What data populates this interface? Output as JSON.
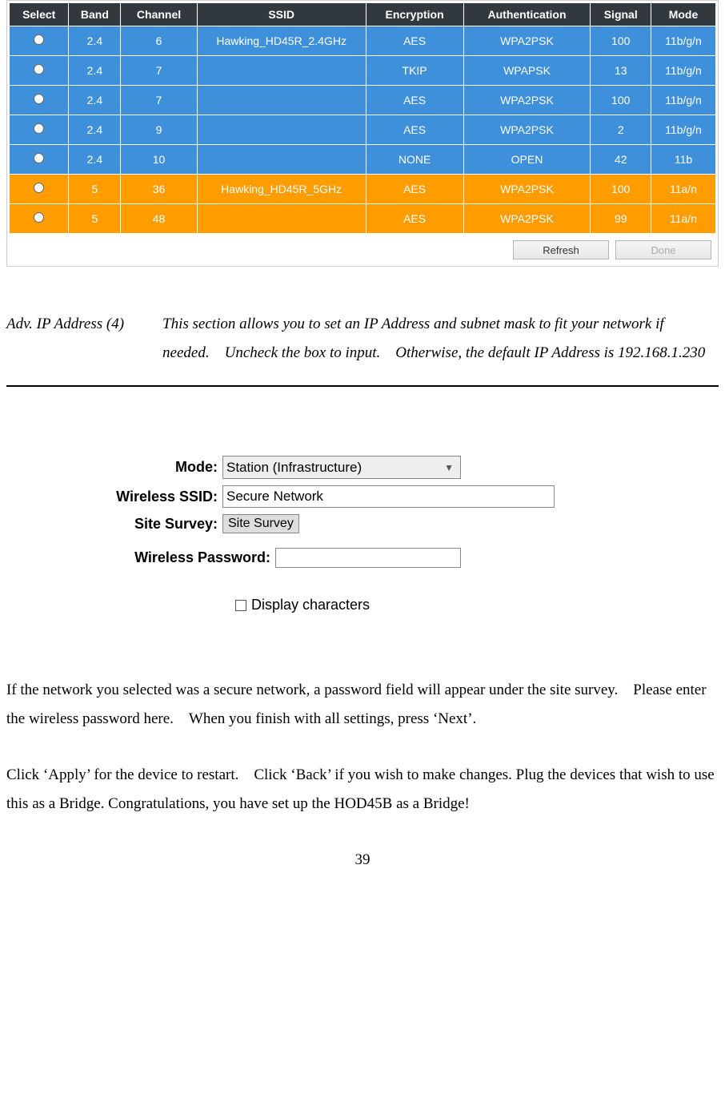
{
  "table": {
    "headers": [
      "Select",
      "Band",
      "Channel",
      "SSID",
      "Encryption",
      "Authentication",
      "Signal",
      "Mode"
    ],
    "rows": [
      {
        "cls": "blue",
        "band": "2.4",
        "channel": "6",
        "ssid": "Hawking_HD45R_2.4GHz",
        "enc": "AES",
        "auth": "WPA2PSK",
        "signal": "100",
        "mode": "11b/g/n"
      },
      {
        "cls": "blue",
        "band": "2.4",
        "channel": "7",
        "ssid": "",
        "enc": "TKIP",
        "auth": "WPAPSK",
        "signal": "13",
        "mode": "11b/g/n"
      },
      {
        "cls": "blue",
        "band": "2.4",
        "channel": "7",
        "ssid": "",
        "enc": "AES",
        "auth": "WPA2PSK",
        "signal": "100",
        "mode": "11b/g/n"
      },
      {
        "cls": "blue",
        "band": "2.4",
        "channel": "9",
        "ssid": "",
        "enc": "AES",
        "auth": "WPA2PSK",
        "signal": "2",
        "mode": "11b/g/n"
      },
      {
        "cls": "blue",
        "band": "2.4",
        "channel": "10",
        "ssid": "",
        "enc": "NONE",
        "auth": "OPEN",
        "signal": "42",
        "mode": "11b"
      },
      {
        "cls": "orange",
        "band": "5",
        "channel": "36",
        "ssid": "Hawking_HD45R_5GHz",
        "enc": "AES",
        "auth": "WPA2PSK",
        "signal": "100",
        "mode": "11a/n"
      },
      {
        "cls": "orange",
        "band": "5",
        "channel": "48",
        "ssid": "",
        "enc": "AES",
        "auth": "WPA2PSK",
        "signal": "99",
        "mode": "11a/n"
      }
    ]
  },
  "buttons": {
    "refresh": "Refresh",
    "done": "Done"
  },
  "desc": {
    "label": "Adv. IP Address (4)",
    "body": "This section allows you to set an IP Address and subnet mask to fit your network if needed. Uncheck the box to input. Otherwise, the default IP Address is 192.168.1.230"
  },
  "form": {
    "mode_label": "Mode:",
    "mode_value": "Station (Infrastructure)",
    "ssid_label": "Wireless SSID:",
    "ssid_value": "Secure Network",
    "survey_label": "Site Survey:",
    "survey_button": "Site Survey",
    "pw_label": "Wireless Password:",
    "pw_value": "",
    "display_chars": "Display characters"
  },
  "body_text": {
    "p1": "If the network you selected was a secure network, a password field will appear under the site survey. Please enter the wireless password here. When you finish with all settings, press ‘Next’.",
    "p2": "Click ‘Apply’ for the device to restart. Click ‘Back’ if you wish to make changes. Plug the devices that wish to use this as a Bridge. Congratulations, you have set up the HOD45B as a Bridge!"
  },
  "pagenum": "39"
}
